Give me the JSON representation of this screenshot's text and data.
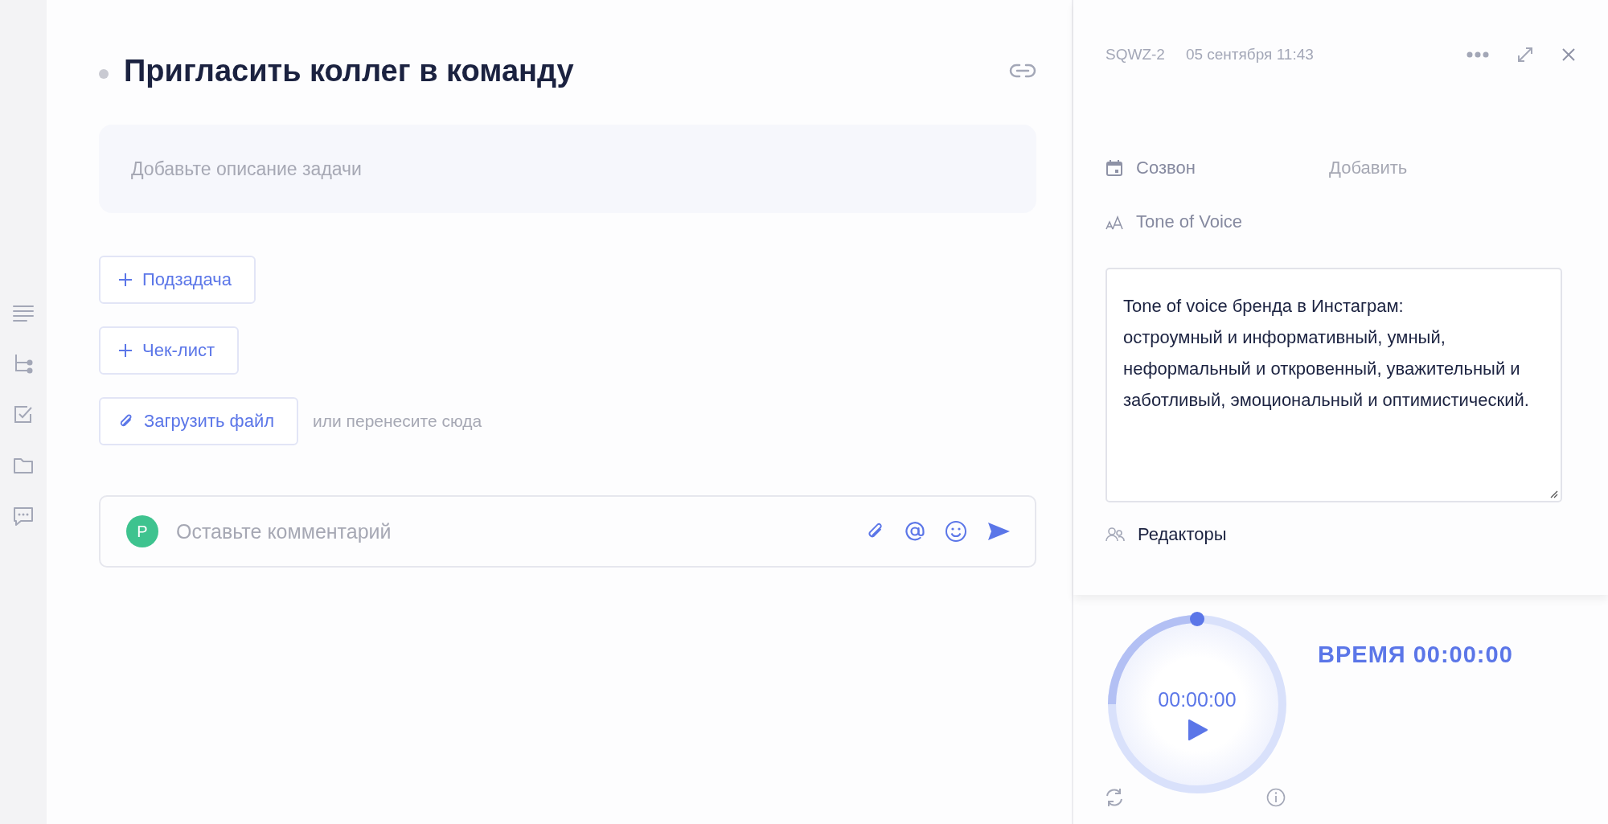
{
  "task": {
    "title": "Пригласить коллег в команду",
    "description": {
      "placeholder": "Добавьте описание задачи"
    },
    "actions": [
      {
        "kind": "add",
        "label": "Подзадача"
      },
      {
        "kind": "add",
        "label": "Чек-лист"
      },
      {
        "kind": "upload",
        "label": "Загрузить файл",
        "hint": "или перенесите сюда"
      }
    ],
    "comment": {
      "avatar": "P",
      "placeholder": "Оставьте комментарий"
    }
  },
  "details": {
    "id": "SQWZ-2",
    "date": "05 сентября 11:43",
    "fields": [
      {
        "kind": "date",
        "label": "Созвон",
        "value": "Добавить"
      },
      {
        "kind": "text",
        "label": "Tone of Voice"
      }
    ],
    "text_value": "Tone of voice бренда в Инстаграм:\nостроумный и информативный, умный, неформальный и откровенный, уважительный и заботливый, эмоциональный и оптимистический.",
    "editors": {
      "label": "Редакторы"
    }
  },
  "timer": {
    "display": "00:00:00",
    "summary": "ВРЕМЯ 00:00:00"
  }
}
